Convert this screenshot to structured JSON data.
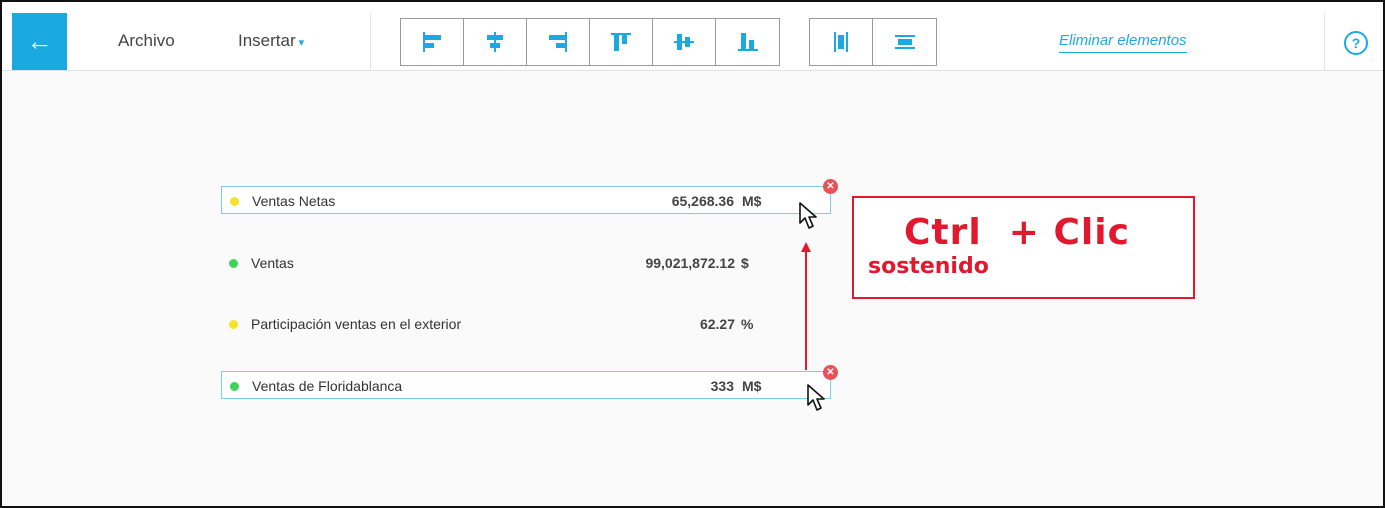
{
  "toolbar": {
    "back_icon": "←",
    "menu_archivo": "Archivo",
    "menu_insertar": "Insertar",
    "caret": "▾",
    "eliminar": "Eliminar elementos",
    "help": "?"
  },
  "kpis": [
    {
      "label": "Ventas Netas",
      "value": "65,268.36",
      "unit": "M$",
      "dot_color": "#f3e42a",
      "selected": true
    },
    {
      "label": "Ventas",
      "value": "99,021,872.12",
      "unit": "$",
      "dot_color": "#3ed45c",
      "selected": false
    },
    {
      "label": "Participación ventas en el exterior",
      "value": "62.27",
      "unit": "%",
      "dot_color": "#f3e42a",
      "selected": false
    },
    {
      "label": "Ventas de Floridablanca",
      "value": "333",
      "unit": "M$",
      "dot_color": "#3ed45c",
      "selected": true
    }
  ],
  "callout": {
    "main": "Ctrl  + Clic",
    "sub": "sostenido"
  },
  "colors": {
    "accent": "#1ba9e1",
    "callout_red": "#e2192e",
    "close_red": "#e8505a"
  }
}
